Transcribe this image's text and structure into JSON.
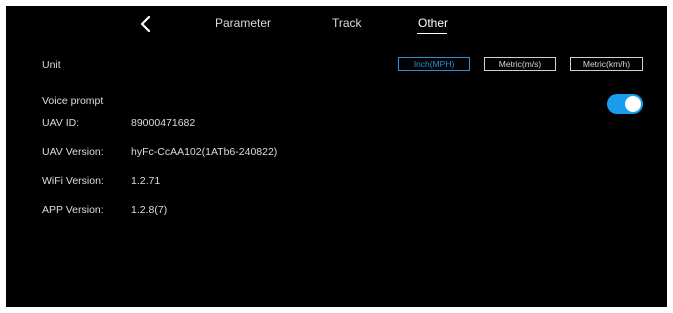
{
  "nav": {
    "back_icon": "chevron-left-icon",
    "tabs": [
      {
        "label": "Parameter",
        "active": false
      },
      {
        "label": "Track",
        "active": false
      },
      {
        "label": "Other",
        "active": true
      }
    ]
  },
  "unit": {
    "label": "Unit",
    "options": [
      {
        "label": "Inch(MPH)",
        "selected": true
      },
      {
        "label": "Metric(m/s)",
        "selected": false
      },
      {
        "label": "Metric(km/h)",
        "selected": false
      }
    ]
  },
  "voice_prompt": {
    "label": "Voice prompt",
    "enabled": true
  },
  "info": {
    "uav_id_label": "UAV ID:",
    "uav_id_value": "89000471682",
    "uav_version_label": "UAV Version:",
    "uav_version_value": "hyFc-CcAA102(1ATb6-240822)",
    "wifi_version_label": "WiFi Version:",
    "wifi_version_value": "1.2.71",
    "app_version_label": "APP Version:",
    "app_version_value": "1.2.8(7)"
  },
  "colors": {
    "background": "#000000",
    "accent": "#1a9cec",
    "selected_unit": "#2a8fdc",
    "text": "#dcdcdc"
  }
}
